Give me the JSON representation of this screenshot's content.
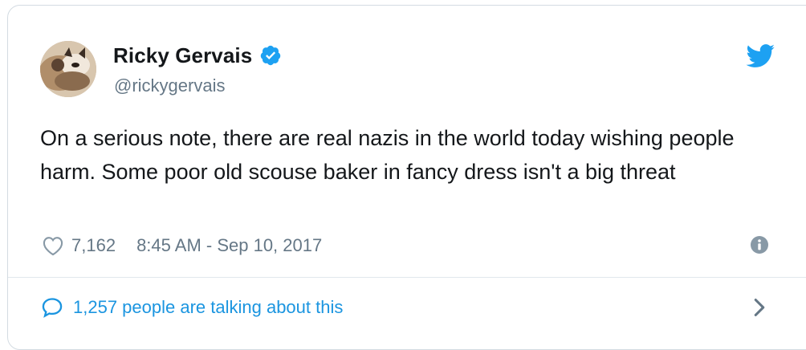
{
  "author": {
    "display_name": "Ricky Gervais",
    "handle": "@rickygervais",
    "verified": true,
    "avatar_icon": "avatar-photo"
  },
  "tweet": {
    "text": "On a serious note, there are real nazis in the world today wishing people harm. Some poor old scouse baker in fancy dress isn't a big threat",
    "like_count": "7,162",
    "timestamp": "8:45 AM - Sep 10, 2017"
  },
  "footer": {
    "conversation_label": "1,257 people are talking about this"
  },
  "icons": {
    "brand": "twitter-bird-icon",
    "verified": "verified-badge-icon",
    "like": "heart-icon",
    "info": "info-icon",
    "reply": "speech-bubble-icon",
    "chevron": "chevron-right-icon"
  },
  "colors": {
    "twitter_blue": "#1da1f2",
    "link_blue": "#1b95e0",
    "text_dark": "#14171a",
    "text_gray": "#657786",
    "border": "#d3dbe2"
  }
}
